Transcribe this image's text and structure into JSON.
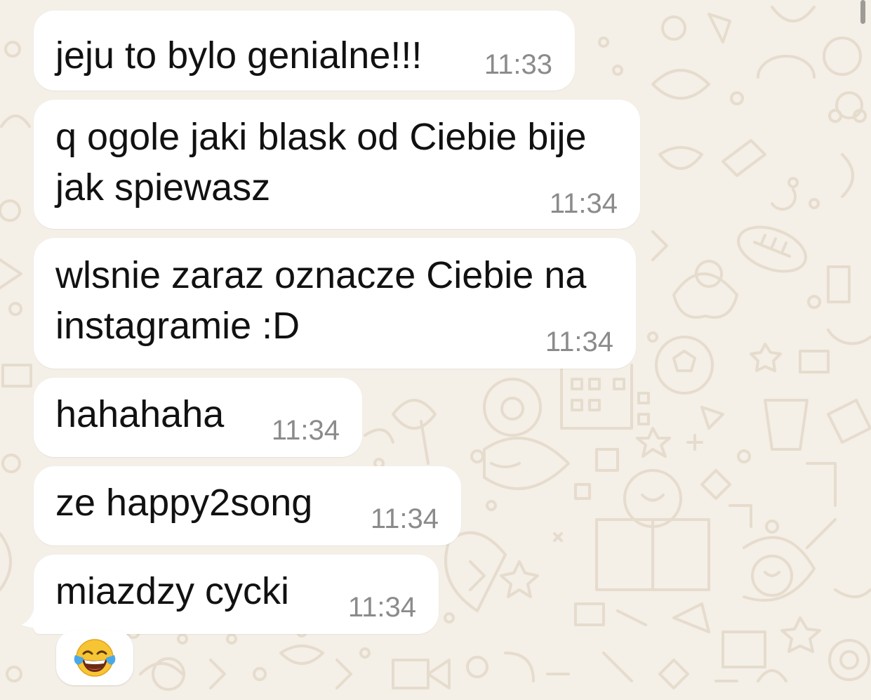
{
  "messages": [
    {
      "lines": [
        "jeju to bylo genialne!!!"
      ],
      "time": "11:33"
    },
    {
      "lines": [
        "q ogole jaki blask od Ciebie bije",
        "jak spiewasz"
      ],
      "time": "11:34"
    },
    {
      "lines": [
        "wlsnie zaraz oznacze Ciebie na",
        "instagramie :D"
      ],
      "time": "11:34"
    },
    {
      "lines": [
        "hahahaha"
      ],
      "time": "11:34"
    },
    {
      "lines": [
        "ze happy2song"
      ],
      "time": "11:34"
    },
    {
      "lines": [
        "miazdzy cycki"
      ],
      "time": "11:34"
    }
  ],
  "reaction": {
    "emoji": "face-with-tears-of-joy-icon"
  },
  "colors": {
    "background": "#f4efe7",
    "bubble": "#ffffff",
    "text": "#111111",
    "time": "#8b8b8b",
    "doodle": "#e6dccd"
  }
}
